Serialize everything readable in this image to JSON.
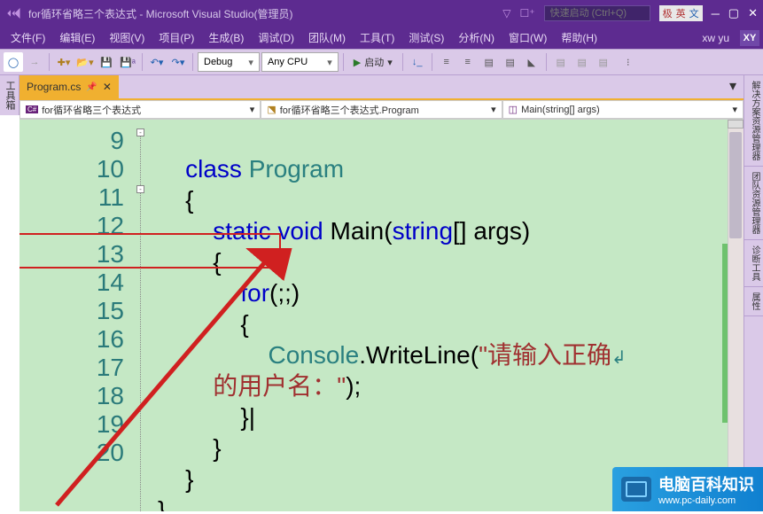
{
  "title": "for循环省略三个表达式 - Microsoft Visual Studio(管理员)",
  "quickLaunch": "快速启动 (Ctrl+Q)",
  "ime": {
    "a": "极",
    "b": "英",
    "c": "文"
  },
  "menu": {
    "file": "文件(F)",
    "edit": "编辑(E)",
    "view": "视图(V)",
    "project": "项目(P)",
    "build": "生成(B)",
    "debug": "调试(D)",
    "team": "团队(M)",
    "tools": "工具(T)",
    "test": "测试(S)",
    "analyze": "分析(N)",
    "window": "窗口(W)",
    "help": "帮助(H)"
  },
  "user": "xw yu",
  "userBadge": "XY",
  "toolbar": {
    "config": "Debug",
    "platform": "Any CPU",
    "start": "启动"
  },
  "leftPanel": "工具箱",
  "rightPanels": {
    "solution": "解决方案资源管理器",
    "team": "团队资源管理器",
    "diag": "诊断工具",
    "prop": "属性"
  },
  "docTab": "Program.cs",
  "navDropdowns": {
    "scope": "for循环省略三个表达式",
    "type": "for循环省略三个表达式.Program",
    "member": "Main(string[] args)"
  },
  "code": {
    "lines": [
      "9",
      "10",
      "11",
      "12",
      "13",
      "14",
      "15",
      "",
      "16",
      "17",
      "18",
      "19",
      "20"
    ],
    "kw_class": "class",
    "cls_program": "Program",
    "brace_open": "{",
    "brace_close": "}",
    "kw_static": "static",
    "kw_void": "void",
    "m_main": "Main",
    "kw_string": "string",
    "m_args": "[] args)",
    "kw_for": "for",
    "for_expr": "(;;)",
    "cls_console": "Console",
    "m_write": ".WriteLine(",
    "str_begin": "\"请输入正确",
    "str_end": "的用户名：\"",
    "stmt_end": ");",
    "caret": "|"
  },
  "watermark": {
    "title": "电脑百科知识",
    "url": "www.pc-daily.com"
  }
}
